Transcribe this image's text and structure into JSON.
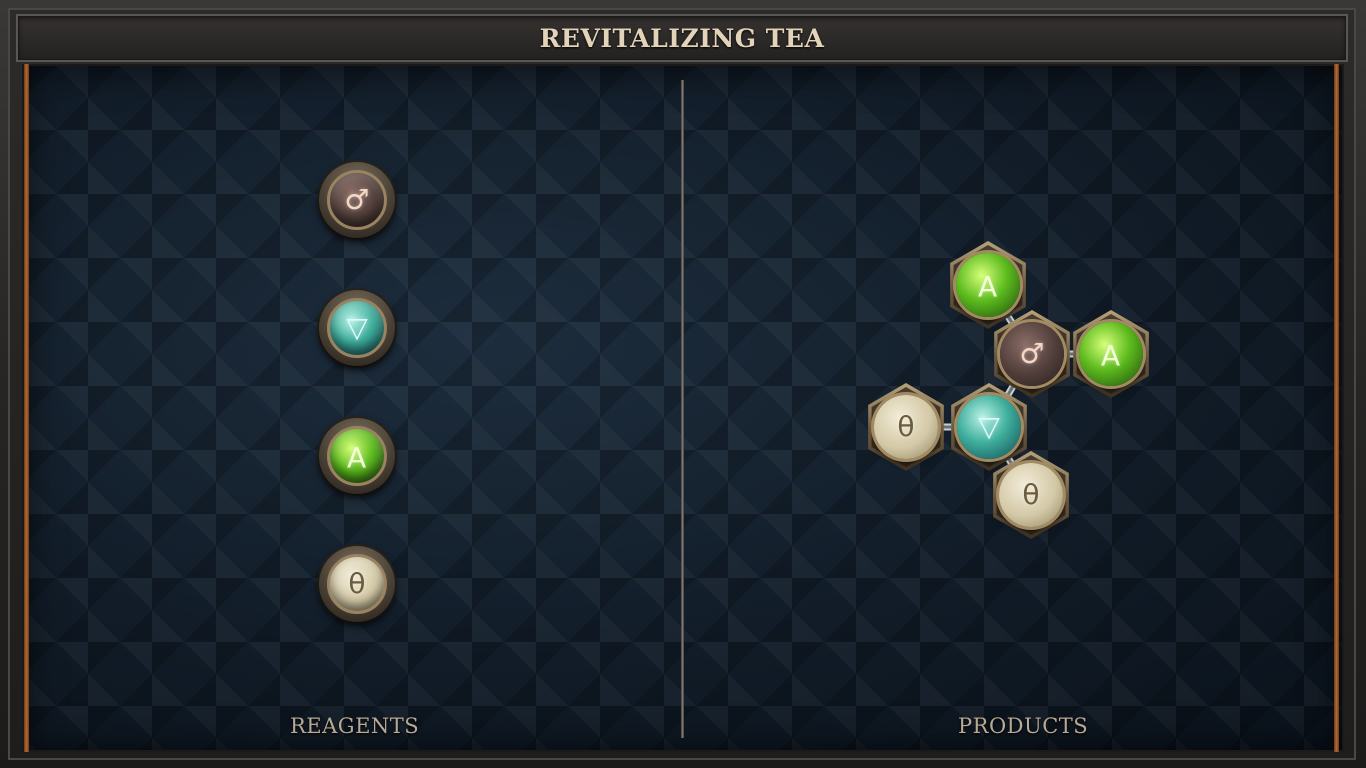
{
  "title": "REVITALIZING TEA",
  "sections": {
    "reagents_label": "REAGENTS",
    "products_label": "PRODUCTS"
  },
  "symbols": {
    "vitae": "♂",
    "water": "▽",
    "earth": "∀",
    "salt": "θ"
  },
  "reagents": [
    {
      "element": "vitae",
      "symbol": "♂"
    },
    {
      "element": "water",
      "symbol": "▽"
    },
    {
      "element": "earth",
      "symbol": "∀"
    },
    {
      "element": "salt",
      "symbol": "θ"
    }
  ],
  "product_atoms": [
    {
      "element": "earth",
      "symbol": "∀"
    },
    {
      "element": "vitae",
      "symbol": "♂"
    },
    {
      "element": "earth",
      "symbol": "∀"
    },
    {
      "element": "salt",
      "symbol": "θ"
    },
    {
      "element": "water",
      "symbol": "▽"
    },
    {
      "element": "salt",
      "symbol": "θ"
    }
  ],
  "colors": {
    "title_text": "#e3d3b8",
    "label_text": "#b7a994",
    "board_bg": "#0f1a25",
    "trim": "#b86a32"
  }
}
